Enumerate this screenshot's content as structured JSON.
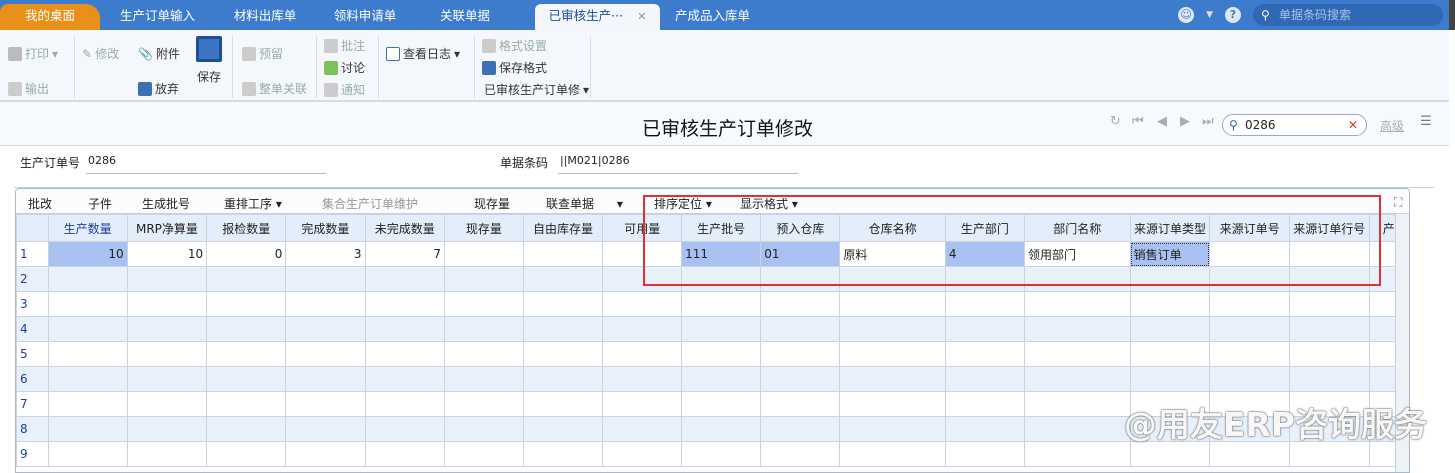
{
  "tabs": [
    "我的桌面",
    "生产订单输入",
    "材料出库单",
    "领料申请单",
    "关联单据",
    "已审核生产···",
    "产成品入库单"
  ],
  "top_search_placeholder": "单据条码搜索",
  "toolbar": {
    "print": "打印",
    "export": "输出",
    "edit": "修改",
    "attach": "附件",
    "abandon": "放弃",
    "save": "保存",
    "reserve": "预留",
    "link": "整单关联",
    "annotate": "批注",
    "discuss": "讨论",
    "notify": "通知",
    "log": "查看日志",
    "format_set": "格式设置",
    "save_format": "保存格式",
    "format_name": "已审核生产订单修"
  },
  "title": "已审核生产订单修改",
  "find_value": "0286",
  "advanced": "高级",
  "fields": {
    "order_no_label": "生产订单号",
    "order_no": "0286",
    "barcode_label": "单据条码",
    "barcode": "||M021|0286"
  },
  "grid_toolbar": [
    "批改",
    "子件",
    "生成批号",
    "重排工序",
    "集合生产订单维护",
    "现存量",
    "联查单据",
    "排序定位",
    "显示格式"
  ],
  "columns": [
    "生产数量",
    "MRP净算量",
    "报检数量",
    "完成数量",
    "未完成数量",
    "现存量",
    "自由库存量",
    "可用量",
    "生产批号",
    "预入仓库",
    "仓库名称",
    "生产部门",
    "部门名称",
    "来源订单类型",
    "来源订单号",
    "来源订单行号",
    "产"
  ],
  "rows": [
    {
      "n": "1",
      "cells": [
        "10",
        "10",
        "0",
        "3",
        "7",
        "",
        "",
        "",
        "111",
        "01",
        "原料",
        "4",
        "领用部门",
        "销售订单",
        "",
        "",
        ""
      ]
    },
    {
      "n": "2",
      "cells": []
    },
    {
      "n": "3",
      "cells": []
    },
    {
      "n": "4",
      "cells": []
    },
    {
      "n": "5",
      "cells": []
    },
    {
      "n": "6",
      "cells": []
    },
    {
      "n": "7",
      "cells": []
    },
    {
      "n": "8",
      "cells": []
    },
    {
      "n": "9",
      "cells": []
    }
  ],
  "watermark": "@用友ERP咨询服务"
}
